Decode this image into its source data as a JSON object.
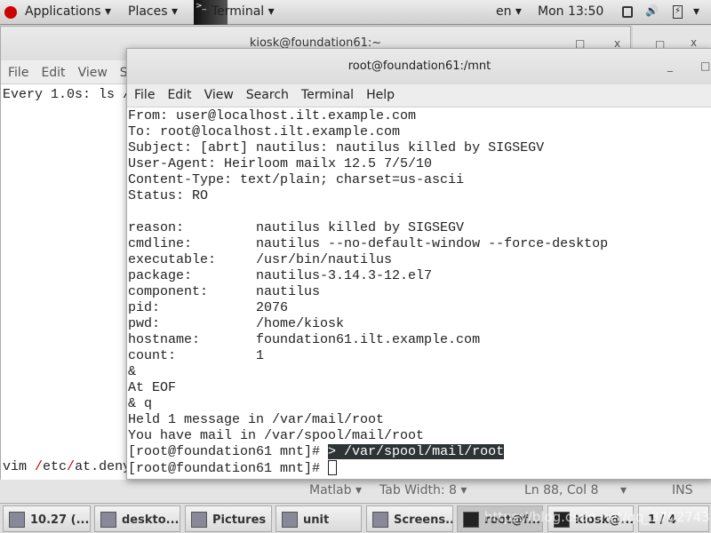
{
  "topbar": {
    "applications": "Applications ▾",
    "places": "Places ▾",
    "terminal": "Terminal ▾",
    "lang": "en ▾",
    "clock": "Mon 13:50",
    "arrow": "▾"
  },
  "back_window": {
    "title": "kiosk@foundation61:~",
    "menu": [
      "File",
      "Edit",
      "View",
      "S"
    ],
    "line1": "Every 1.0s: ls /",
    "last_line": [
      "vim ",
      "/",
      "etc",
      "/",
      "at.deny"
    ]
  },
  "front_window": {
    "title": "root@foundation61:/mnt",
    "menu": [
      "File",
      "Edit",
      "View",
      "Search",
      "Terminal",
      "Help"
    ],
    "lines": [
      "From: user@localhost.ilt.example.com",
      "To: root@localhost.ilt.example.com",
      "Subject: [abrt] nautilus: nautilus killed by SIGSEGV",
      "User-Agent: Heirloom mailx 12.5 7/5/10",
      "Content-Type: text/plain; charset=us-ascii",
      "Status: RO",
      "",
      "reason:         nautilus killed by SIGSEGV",
      "cmdline:        nautilus --no-default-window --force-desktop",
      "executable:     /usr/bin/nautilus",
      "package:        nautilus-3.14.3-12.el7",
      "component:      nautilus",
      "pid:            2076",
      "pwd:            /home/kiosk",
      "hostname:       foundation61.ilt.example.com",
      "count:          1",
      "&",
      "At EOF",
      "& q",
      "Held 1 message in /var/mail/root",
      "You have mail in /var/spool/mail/root"
    ],
    "prompt1": "[root@foundation61 mnt]# ",
    "selected": "> /var/spool/mail/root",
    "prompt2": "[root@foundation61 mnt]# "
  },
  "statusbar": {
    "lang": "Matlab ▾",
    "tab": "Tab Width: 8 ▾",
    "pos": "Ln 88, Col 8",
    "arrow": "▾",
    "mode": "INS"
  },
  "taskbar": [
    "10.27 (...",
    "deskto...",
    "Pictures",
    "unit",
    "Screens...",
    "root@f...",
    "kiosk@...",
    "1 / 4"
  ],
  "watermark": "https://blog.csdn.net/qq_37027438"
}
